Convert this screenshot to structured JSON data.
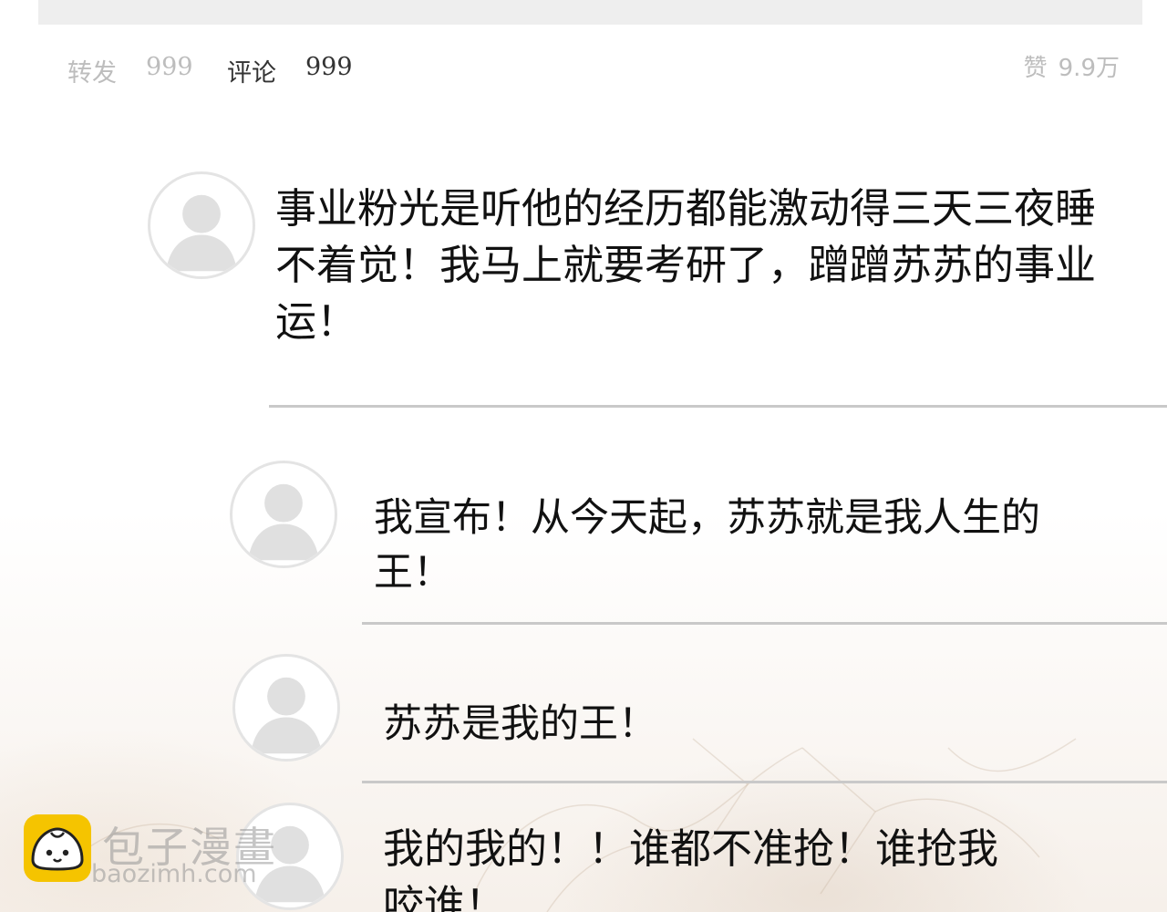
{
  "post_stats": {
    "repost_label": "转发",
    "repost_count": "999",
    "comment_label": "评论",
    "comment_count": "999",
    "like_label": "赞",
    "like_count": "9.9万"
  },
  "comments": [
    {
      "text": "事业粉光是听他的经历都能激动得三天三夜睡不着觉！我马上就要考研了，蹭蹭苏苏的事业运！"
    },
    {
      "text": "我宣布！从今天起，苏苏就是我人生的王！"
    },
    {
      "text": "苏苏是我的王！"
    },
    {
      "text": "我的我的！！谁都不准抢！谁抢我咬谁！"
    }
  ],
  "watermark": {
    "title": "包子漫畫",
    "url": "baozimh.com"
  },
  "colors": {
    "muted_text": "#bdbdbd",
    "divider": "#c9c9c9",
    "top_bar": "#eeeeee",
    "watermark_logo": "#f5c400"
  },
  "icons": [
    "default-avatar-icon",
    "baozi-logo-icon"
  ]
}
